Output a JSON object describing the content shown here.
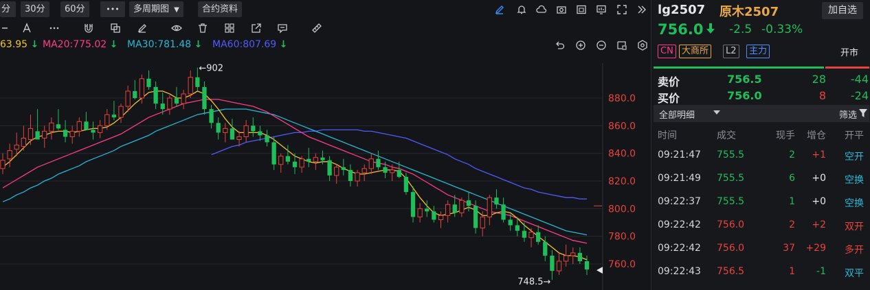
{
  "toolbar": {
    "period_fragment": "分",
    "period_30m": "30分",
    "period_60m": "60分",
    "more_label": "•••",
    "multi_period": "多周期图",
    "contract_info": "合约资料"
  },
  "ma_row": [
    {
      "label": "63.95",
      "color": "#f4c430"
    },
    {
      "label": "MA20:775.02",
      "color": "#ff3b8a"
    },
    {
      "label": "MA30:781.48",
      "color": "#26b8d6"
    },
    {
      "label": "MA60:807.69",
      "color": "#4f5bff"
    }
  ],
  "chart_labels": {
    "high_marker": "902",
    "low_marker": "748.5",
    "y_ticks": [
      "880.0",
      "860.0",
      "840.0",
      "820.0",
      "800.0",
      "780.0",
      "760.0"
    ]
  },
  "chart_data": {
    "type": "candlestick",
    "ylim": [
      745,
      905
    ],
    "y_ticks": [
      880,
      860,
      840,
      820,
      800,
      780,
      760
    ],
    "marked_high": 902,
    "marked_low": 748.5,
    "ohlc": [
      [
        829,
        840,
        825,
        835
      ],
      [
        836,
        847,
        830,
        842
      ],
      [
        843,
        855,
        838,
        846
      ],
      [
        845,
        860,
        842,
        851
      ],
      [
        850,
        868,
        846,
        858
      ],
      [
        856,
        872,
        852,
        850
      ],
      [
        851,
        860,
        844,
        856
      ],
      [
        856,
        866,
        850,
        862
      ],
      [
        861,
        872,
        857,
        858
      ],
      [
        857,
        864,
        848,
        852
      ],
      [
        852,
        860,
        847,
        856
      ],
      [
        856,
        866,
        852,
        863
      ],
      [
        863,
        870,
        859,
        857
      ],
      [
        857,
        863,
        850,
        855
      ],
      [
        855,
        864,
        851,
        860
      ],
      [
        860,
        872,
        857,
        868
      ],
      [
        868,
        878,
        864,
        866
      ],
      [
        866,
        876,
        862,
        874
      ],
      [
        874,
        889,
        870,
        885
      ],
      [
        885,
        893,
        879,
        880
      ],
      [
        880,
        897,
        876,
        894
      ],
      [
        894,
        900,
        886,
        888
      ],
      [
        888,
        892,
        872,
        876
      ],
      [
        876,
        884,
        868,
        872
      ],
      [
        872,
        882,
        868,
        880
      ],
      [
        880,
        888,
        874,
        876
      ],
      [
        876,
        886,
        872,
        883
      ],
      [
        883,
        900,
        880,
        895
      ],
      [
        895,
        902,
        885,
        888
      ],
      [
        888,
        892,
        868,
        872
      ],
      [
        872,
        875,
        858,
        862
      ],
      [
        862,
        866,
        850,
        855
      ],
      [
        855,
        862,
        848,
        858
      ],
      [
        858,
        865,
        852,
        850
      ],
      [
        850,
        856,
        845,
        852
      ],
      [
        852,
        864,
        848,
        860
      ],
      [
        860,
        866,
        852,
        856
      ],
      [
        856,
        860,
        849,
        853
      ],
      [
        853,
        857,
        845,
        848
      ],
      [
        848,
        852,
        828,
        832
      ],
      [
        832,
        840,
        826,
        838
      ],
      [
        838,
        846,
        832,
        834
      ],
      [
        834,
        840,
        825,
        830
      ],
      [
        830,
        838,
        826,
        836
      ],
      [
        836,
        844,
        830,
        834
      ],
      [
        834,
        840,
        828,
        837
      ],
      [
        837,
        842,
        832,
        835
      ],
      [
        835,
        838,
        820,
        824
      ],
      [
        824,
        832,
        818,
        830
      ],
      [
        830,
        836,
        824,
        828
      ],
      [
        828,
        832,
        816,
        820
      ],
      [
        820,
        828,
        816,
        826
      ],
      [
        826,
        832,
        820,
        829
      ],
      [
        829,
        840,
        825,
        836
      ],
      [
        836,
        842,
        828,
        830
      ],
      [
        830,
        834,
        822,
        826
      ],
      [
        826,
        832,
        820,
        828
      ],
      [
        828,
        834,
        822,
        823
      ],
      [
        823,
        826,
        810,
        812
      ],
      [
        812,
        816,
        790,
        794
      ],
      [
        794,
        804,
        790,
        800
      ],
      [
        800,
        806,
        794,
        798
      ],
      [
        798,
        802,
        790,
        792
      ],
      [
        792,
        798,
        786,
        795
      ],
      [
        795,
        806,
        790,
        803
      ],
      [
        803,
        810,
        794,
        797
      ],
      [
        797,
        808,
        794,
        806
      ],
      [
        806,
        812,
        798,
        802
      ],
      [
        802,
        806,
        782,
        786
      ],
      [
        786,
        798,
        780,
        794
      ],
      [
        794,
        810,
        788,
        808
      ],
      [
        808,
        814,
        800,
        803
      ],
      [
        803,
        808,
        790,
        792
      ],
      [
        792,
        796,
        784,
        788
      ],
      [
        788,
        794,
        780,
        784
      ],
      [
        784,
        790,
        776,
        779
      ],
      [
        779,
        786,
        772,
        783
      ],
      [
        783,
        788,
        774,
        776
      ],
      [
        776,
        780,
        762,
        766
      ],
      [
        766,
        770,
        748.5,
        755
      ],
      [
        755,
        768,
        752,
        762
      ],
      [
        762,
        774,
        758,
        766
      ],
      [
        766,
        772,
        760,
        768
      ],
      [
        768,
        772,
        760,
        762
      ],
      [
        762,
        766,
        752,
        756
      ]
    ],
    "ma5": [
      830,
      834,
      839,
      844,
      849,
      852,
      853,
      855,
      856,
      856,
      855,
      856,
      857,
      858,
      858,
      859,
      862,
      866,
      871,
      876,
      880,
      884,
      885,
      885,
      883,
      880,
      880,
      882,
      885,
      883,
      878,
      872,
      865,
      859,
      855,
      855,
      855,
      855,
      853,
      850,
      846,
      842,
      838,
      836,
      834,
      833,
      834,
      834,
      832,
      829,
      827,
      825,
      825,
      826,
      827,
      828,
      828,
      827,
      822,
      815,
      808,
      802,
      797,
      795,
      796,
      797,
      799,
      801,
      799,
      795,
      795,
      797,
      798,
      797,
      793,
      788,
      784,
      780,
      776,
      772,
      768,
      766,
      766,
      765,
      763
    ],
    "ma20": [
      815,
      818,
      821,
      824,
      827,
      830,
      832,
      834,
      836,
      838,
      840,
      842,
      844,
      846,
      848,
      850,
      852,
      854,
      857,
      860,
      863,
      866,
      868,
      870,
      872,
      874,
      876,
      877,
      878,
      879,
      879,
      879,
      878,
      877,
      876,
      875,
      874,
      872,
      870,
      867,
      864,
      861,
      858,
      855,
      852,
      850,
      848,
      846,
      844,
      842,
      840,
      838,
      836,
      834,
      833,
      832,
      830,
      829,
      827,
      825,
      822,
      819,
      816,
      813,
      810,
      808,
      806,
      804,
      802,
      800,
      798,
      797,
      796,
      795,
      793,
      791,
      789,
      787,
      785,
      783,
      781,
      779,
      777,
      776,
      775
    ],
    "ma30": [
      805,
      807,
      810,
      812,
      815,
      817,
      820,
      822,
      825,
      827,
      829,
      831,
      834,
      836,
      838,
      840,
      842,
      845,
      847,
      849,
      851,
      853,
      856,
      858,
      860,
      862,
      864,
      866,
      868,
      869,
      870,
      871,
      872,
      872,
      872,
      872,
      871,
      870,
      869,
      868,
      866,
      864,
      862,
      860,
      858,
      856,
      854,
      852,
      850,
      848,
      846,
      844,
      842,
      840,
      838,
      836,
      834,
      832,
      830,
      828,
      826,
      824,
      822,
      820,
      818,
      816,
      814,
      812,
      810,
      808,
      806,
      804,
      802,
      800,
      798,
      796,
      794,
      792,
      790,
      788,
      786,
      784,
      783,
      782,
      781
    ],
    "ma60": [
      null,
      null,
      null,
      null,
      null,
      null,
      null,
      null,
      null,
      null,
      null,
      null,
      null,
      null,
      null,
      null,
      null,
      null,
      null,
      null,
      null,
      null,
      null,
      null,
      null,
      null,
      null,
      null,
      null,
      null,
      839,
      841,
      843,
      845,
      846,
      848,
      849,
      850,
      851,
      852,
      853,
      854,
      855,
      855,
      856,
      856,
      857,
      857,
      857,
      857,
      857,
      857,
      856,
      856,
      855,
      854,
      853,
      852,
      851,
      849,
      847,
      845,
      843,
      841,
      839,
      836,
      834,
      832,
      829,
      827,
      825,
      823,
      821,
      819,
      817,
      815,
      814,
      812,
      811,
      810,
      809,
      808,
      808,
      807,
      807
    ]
  },
  "right_panel": {
    "symbol_code": "lg2507",
    "symbol_name": "原木2507",
    "add_watch": "加自选",
    "last_price": "756.0",
    "change": "-2.5",
    "change_pct": "-0.33%",
    "tags": {
      "cn": "CN",
      "exchange": "大商所",
      "level": "L2",
      "main": "主力"
    },
    "market_status": "开市",
    "ask": {
      "label": "卖价",
      "price": "756.5",
      "volume": "28",
      "delta": "-44"
    },
    "bid": {
      "label": "买价",
      "price": "756.0",
      "volume": "8",
      "delta": "-24"
    },
    "detail_title": "全部明细",
    "filter_label": "筛选",
    "tick_headers": [
      "时间",
      "成交",
      "现手",
      "增仓",
      "开平"
    ],
    "ticks": [
      {
        "time": "09:21:47",
        "price": "755.5",
        "vol": "2",
        "oi": "+1",
        "type": "空开"
      },
      {
        "time": "09:21:49",
        "price": "755.5",
        "vol": "6",
        "oi": "+0",
        "type": "空换"
      },
      {
        "time": "09:22:37",
        "price": "755.5",
        "vol": "1",
        "oi": "+0",
        "type": "空换"
      },
      {
        "time": "09:22:42",
        "price": "756.0",
        "vol": "2",
        "oi": "+2",
        "type": "双开"
      },
      {
        "time": "09:22:42",
        "price": "756.0",
        "vol": "37",
        "oi": "+29",
        "type": "多开"
      },
      {
        "time": "09:22:43",
        "price": "756.5",
        "vol": "1",
        "oi": "-1",
        "type": "双平"
      }
    ]
  },
  "colors": {
    "up": "#e8433c",
    "down": "#1fbe5a",
    "ma5": "#f4c430",
    "ma10": "#2f8fff",
    "ma20": "#ff3b8a",
    "ma30": "#26b8d6",
    "ma60": "#4f5bff",
    "axis_text": "#e8433c"
  }
}
